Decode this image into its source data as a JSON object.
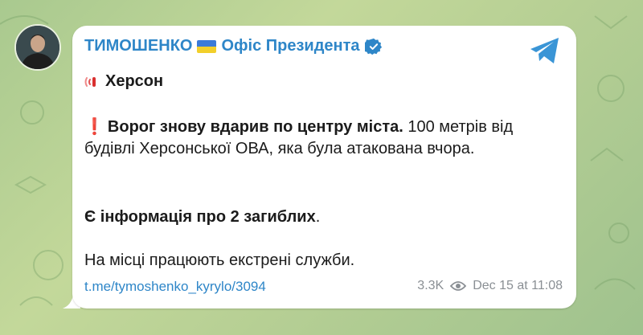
{
  "message": {
    "author": "ТИМОШЕНКО",
    "author_suffix": "Офіс Президента",
    "city": "Херсон",
    "p1_bold": "Ворог знову вдарив по центру міста.",
    "p1_rest": " 100 метрів від будівлі Херсонської ОВА, яка була атакована вчора.",
    "p2_bold": "Є інформація про 2 загиблих",
    "p2_rest": ".",
    "p3": "На місці працюють екстрені служби.",
    "link": "t.me/tymoshenko_kyrylo/3094",
    "views": "3.3K",
    "timestamp": "Dec 15 at 11:08"
  },
  "icons": {
    "flag": "ukraine-flag-icon",
    "verified": "verified-badge-icon",
    "share": "telegram-share-icon",
    "siren": "siren-icon",
    "exclamation": "red-exclamation-icon",
    "views": "eye-icon"
  },
  "colors": {
    "accent": "#2e86c8",
    "exclamation": "#e02a2a",
    "meta": "#8a8f94"
  }
}
